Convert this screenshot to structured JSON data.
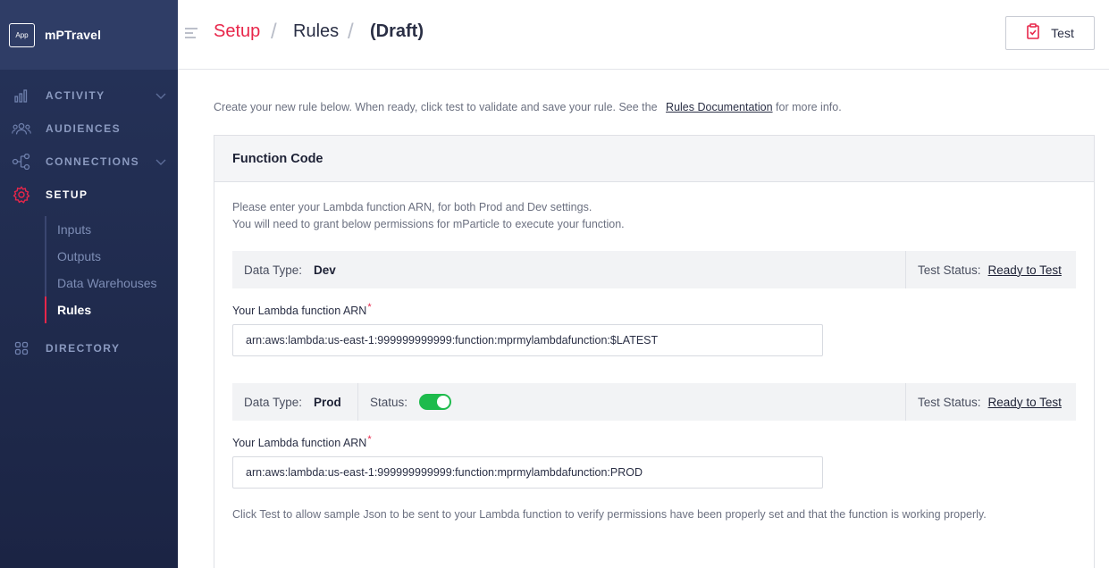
{
  "app": {
    "badge": "App",
    "name": "mPTravel"
  },
  "nav": {
    "items": [
      {
        "label": "ACTIVITY",
        "icon": "bar-chart-icon"
      },
      {
        "label": "AUDIENCES",
        "icon": "people-icon"
      },
      {
        "label": "CONNECTIONS",
        "icon": "connections-icon"
      },
      {
        "label": "SETUP",
        "icon": "gear-icon"
      },
      {
        "label": "DIRECTORY",
        "icon": "grid-icon"
      }
    ],
    "setup_sub": [
      "Inputs",
      "Outputs",
      "Data Warehouses",
      "Rules"
    ]
  },
  "header": {
    "crumbs": [
      "Setup",
      "Rules",
      "(Draft)"
    ],
    "separator": "/",
    "test_label": "Test"
  },
  "intro": {
    "text": "Create your new rule below. When ready, click test to validate and save your rule. See the",
    "link": "Rules Documentation",
    "suffix": "for more info."
  },
  "panel": {
    "title": "Function Code",
    "desc1": "Please enter your Lambda function ARN, for both Prod and Dev settings.",
    "desc2": "You will need to grant below permissions for mParticle to execute your function.",
    "dev": {
      "type_label": "Data Type:",
      "type_value": "Dev",
      "status_label": "Test Status:",
      "status_link": "Ready to Test",
      "field_label": "Your Lambda function ARN",
      "required": "*",
      "value": "arn:aws:lambda:us-east-1:999999999999:function:mprmylambdafunction:$LATEST"
    },
    "prod": {
      "type_label": "Data Type:",
      "type_value": "Prod",
      "toggle_label": "Status:",
      "toggle_on": true,
      "status_label": "Test Status:",
      "status_link": "Ready to Test",
      "field_label": "Your Lambda function ARN",
      "required": "*",
      "value": "arn:aws:lambda:us-east-1:999999999999:function:mprmylambdafunction:PROD"
    },
    "footnote": "Click Test to allow sample Json to be sent to your Lambda function to verify permissions have been properly set and that the function is working properly."
  },
  "colors": {
    "accent": "#e8264a",
    "sidebar": "#1f2a4c",
    "toggle_on": "#1dbb4c"
  }
}
